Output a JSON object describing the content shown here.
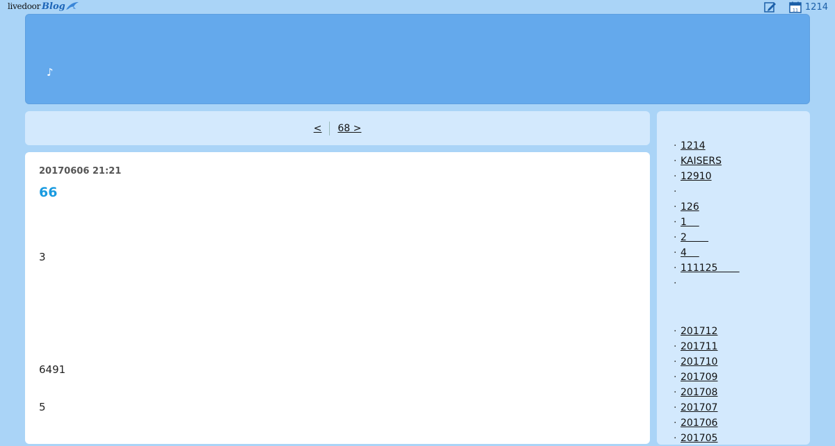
{
  "topbar": {
    "logo_text": "livedoor",
    "logo_blog": "Blog",
    "calendar_count": "1214"
  },
  "header": {
    "note": "♪"
  },
  "pager": {
    "prev": "<",
    "next": "68  >    "
  },
  "article": {
    "date": "20170606 21:21",
    "title": "66",
    "paragraphs": [
      "3",
      "6491",
      "5"
    ]
  },
  "sidebar": {
    "links": [
      "1214",
      "KAISERS",
      "12910",
      "",
      "126",
      "1    ",
      "2       ",
      "4    ",
      "111125       ",
      ""
    ],
    "archives": [
      "201712",
      "201711",
      "201710",
      "201709",
      "201708",
      "201707",
      "201706",
      "201705"
    ]
  },
  "colors": {
    "background": "#aad4f7",
    "header": "#64a9ec",
    "panel": "#d3e9fd",
    "title": "#1a9be0"
  }
}
